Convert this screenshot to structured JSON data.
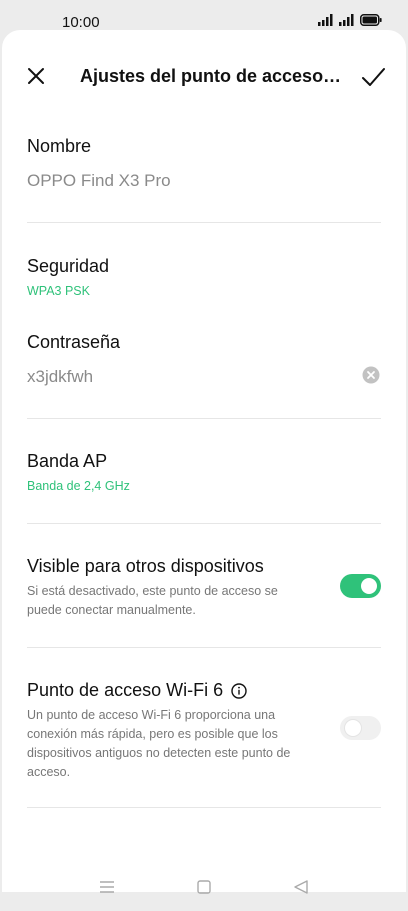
{
  "status_bar": {
    "time": "10:00"
  },
  "header": {
    "title": "Ajustes del punto de acceso…"
  },
  "fields": {
    "name": {
      "label": "Nombre",
      "value": "OPPO Find X3 Pro"
    },
    "security": {
      "label": "Seguridad",
      "value": "WPA3 PSK"
    },
    "password": {
      "label": "Contraseña",
      "value": "x3jdkfwh"
    },
    "band": {
      "label": "Banda AP",
      "value": "Banda de 2,4 GHz"
    },
    "visible": {
      "label": "Visible para otros dispositivos",
      "desc_line1": "Si está desactivado, este punto de acceso se",
      "desc_line2": "puede conectar manualmente.",
      "enabled": true
    },
    "wifi6": {
      "label": "Punto de acceso Wi-Fi 6",
      "desc_line1": "Un punto de acceso Wi-Fi 6 proporciona una",
      "desc_line2": "conexión más rápida, pero es posible que los",
      "desc_line3": "dispositivos antiguos no detecten este punto de",
      "desc_line4": "acceso.",
      "enabled": false
    }
  },
  "colors": {
    "accent": "#2fc27a",
    "background": "#ececec",
    "sheet": "#ffffff"
  },
  "icons": [
    "close-icon",
    "checkmark-icon",
    "clear-icon",
    "info-icon",
    "menu-icon",
    "home-icon",
    "back-icon"
  ]
}
